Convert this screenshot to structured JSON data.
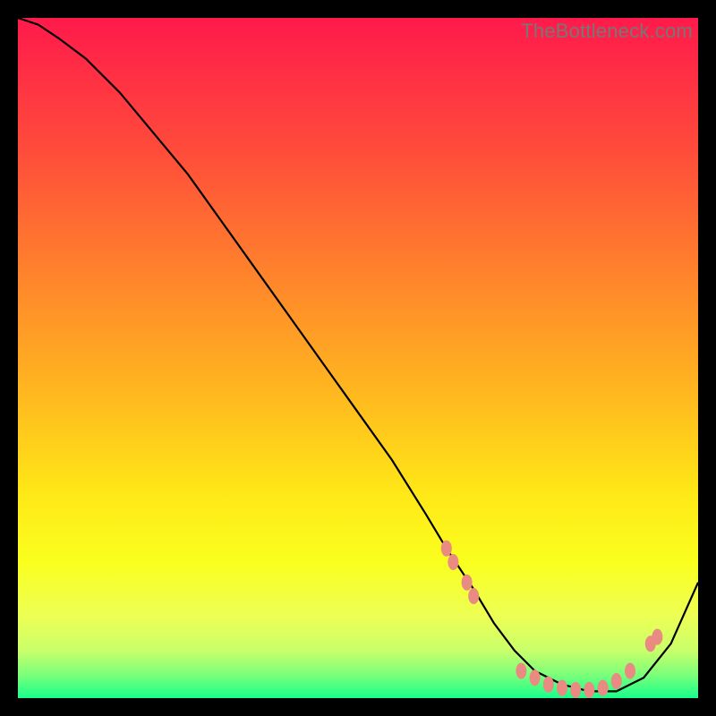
{
  "watermark": "TheBottleneck.com",
  "chart_data": {
    "type": "line",
    "title": "",
    "xlabel": "",
    "ylabel": "",
    "xlim": [
      0,
      100
    ],
    "ylim": [
      0,
      100
    ],
    "grid": false,
    "legend": false,
    "background_gradient": {
      "stops": [
        {
          "offset": 0.0,
          "color": "#ff1a4b"
        },
        {
          "offset": 0.2,
          "color": "#ff4d3a"
        },
        {
          "offset": 0.4,
          "color": "#ff8a2a"
        },
        {
          "offset": 0.55,
          "color": "#ffb71f"
        },
        {
          "offset": 0.7,
          "color": "#ffe817"
        },
        {
          "offset": 0.8,
          "color": "#faff1e"
        },
        {
          "offset": 0.88,
          "color": "#edff55"
        },
        {
          "offset": 0.93,
          "color": "#c9ff6a"
        },
        {
          "offset": 0.965,
          "color": "#7dff7a"
        },
        {
          "offset": 1.0,
          "color": "#18ff8a"
        }
      ]
    },
    "series": [
      {
        "name": "curve",
        "color": "#000000",
        "x": [
          0,
          3,
          6,
          10,
          15,
          20,
          25,
          30,
          35,
          40,
          45,
          50,
          55,
          60,
          63,
          67,
          70,
          73,
          76,
          80,
          84,
          88,
          92,
          96,
          100
        ],
        "y": [
          100,
          99,
          97,
          94,
          89,
          83,
          77,
          70,
          63,
          56,
          49,
          42,
          35,
          27,
          22,
          16,
          11,
          7,
          4,
          2,
          1,
          1,
          3,
          8,
          17
        ]
      }
    ],
    "markers": {
      "color": "#e98b83",
      "points": [
        {
          "x": 63,
          "y": 22
        },
        {
          "x": 64,
          "y": 20
        },
        {
          "x": 66,
          "y": 17
        },
        {
          "x": 67,
          "y": 15
        },
        {
          "x": 74,
          "y": 4
        },
        {
          "x": 76,
          "y": 3
        },
        {
          "x": 78,
          "y": 2
        },
        {
          "x": 80,
          "y": 1.5
        },
        {
          "x": 82,
          "y": 1.2
        },
        {
          "x": 84,
          "y": 1.2
        },
        {
          "x": 86,
          "y": 1.5
        },
        {
          "x": 88,
          "y": 2.5
        },
        {
          "x": 90,
          "y": 4
        },
        {
          "x": 93,
          "y": 8
        },
        {
          "x": 94,
          "y": 9
        }
      ]
    }
  }
}
